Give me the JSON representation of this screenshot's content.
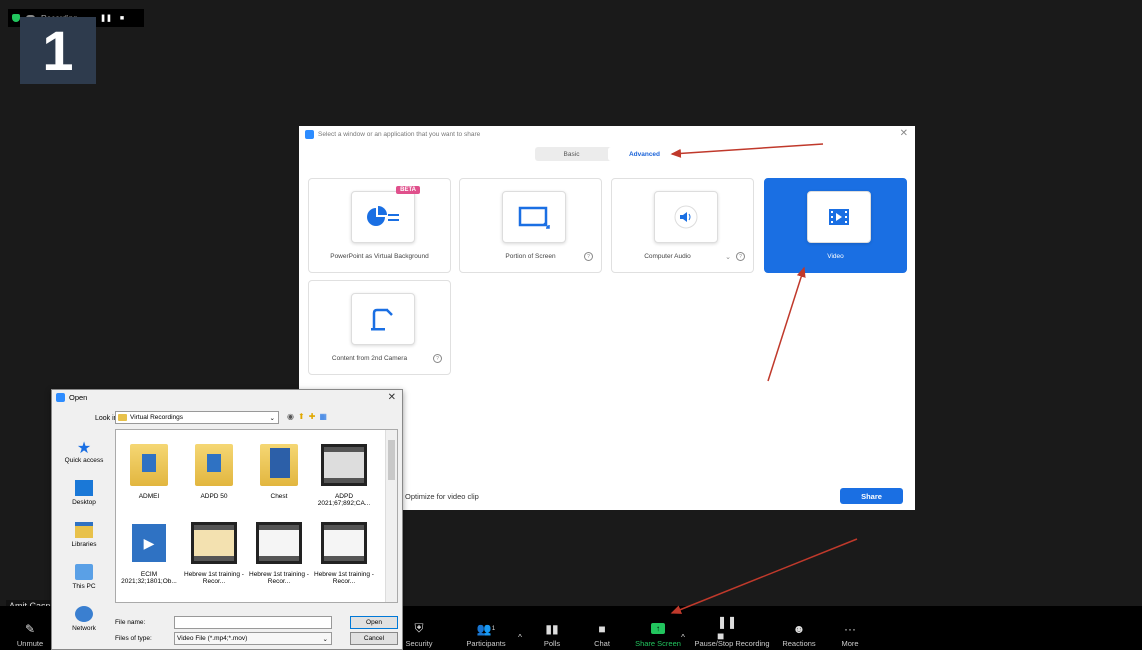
{
  "meeting": {
    "recording_label": "Recording...",
    "participant_number": "1",
    "participant_name": "Amit Casp"
  },
  "toolbar": {
    "unmute": "Unmute",
    "security": "Security",
    "participants": "Participants",
    "participants_count": "1",
    "polls": "Polls",
    "chat": "Chat",
    "share_screen": "Share Screen",
    "pause_stop_recording": "Pause/Stop Recording",
    "reactions": "Reactions",
    "more": "More"
  },
  "share_dialog": {
    "title": "Select a window or an application that you want to share",
    "tabs": [
      "Basic",
      "Advanced"
    ],
    "cards": {
      "powerpoint": "PowerPoint as Virtual Background",
      "beta": "BETA",
      "portion": "Portion of Screen",
      "audio": "Computer Audio",
      "video": "Video",
      "camera": "Content from 2nd Camera"
    },
    "optimize": "Optimize for video clip",
    "share_button": "Share"
  },
  "open_dialog": {
    "title": "Open",
    "look_in_label": "Look in:",
    "look_in_value": "Virtual Recordings",
    "places": [
      "Quick access",
      "Desktop",
      "Libraries",
      "This PC",
      "Network"
    ],
    "files": [
      {
        "name": "ADMEI",
        "kind": "folder"
      },
      {
        "name": "ADPD 50",
        "kind": "folder"
      },
      {
        "name": "Chest",
        "kind": "folder-blue"
      },
      {
        "name": "ADPD 2021;67;892;CA...",
        "kind": "video"
      },
      {
        "name": "ECIM 2021;32;1801;Ob...",
        "kind": "video-blue"
      },
      {
        "name": "Hebrew 1st training - Recor...",
        "kind": "video"
      },
      {
        "name": "Hebrew 1st training - Recor...",
        "kind": "video"
      },
      {
        "name": "Hebrew 1st training - Recor...",
        "kind": "video"
      }
    ],
    "file_name_label": "File name:",
    "file_name_value": "",
    "files_of_type_label": "Files of type:",
    "files_of_type_value": "Video File (*.mp4;*.mov)",
    "open_button": "Open",
    "cancel_button": "Cancel"
  },
  "colors": {
    "zoom_blue": "#1a6fe3",
    "annotation_red": "#c0392b",
    "share_green": "#22c55e"
  }
}
